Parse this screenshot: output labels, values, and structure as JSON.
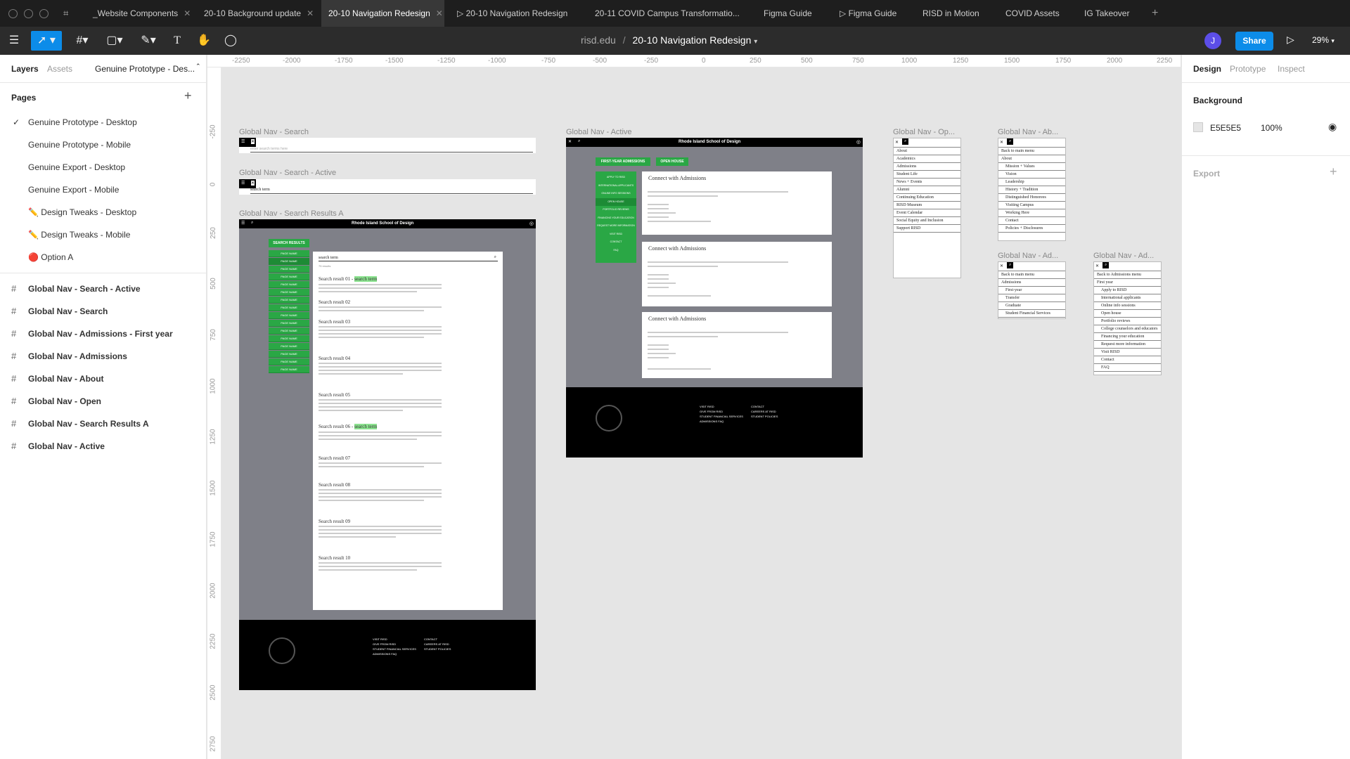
{
  "titlebar": {
    "tabs": [
      "_Website Components",
      "20-10 Background update",
      "20-10 Navigation Redesign",
      "20-10 Navigation Redesign",
      "20-11 COVID Campus Transformatio...",
      "Figma Guide",
      "Figma Guide",
      "RISD in Motion",
      "COVID Assets",
      "IG Takeover"
    ]
  },
  "toolbar": {
    "breadcrumb_team": "risd.edu",
    "breadcrumb_sep": "/",
    "file_title": "20-10 Navigation Redesign",
    "avatar": "J",
    "share": "Share",
    "zoom": "29%"
  },
  "left": {
    "tab_layers": "Layers",
    "tab_assets": "Assets",
    "page_selector": "Genuine Prototype - Des...",
    "pages_title": "Pages",
    "pages": [
      {
        "label": "Genuine Prototype - Desktop",
        "selected": true
      },
      {
        "label": "Genuine Prototype - Mobile"
      },
      {
        "label": "Genuine Export - Desktop"
      },
      {
        "label": "Genuine Export - Mobile"
      },
      {
        "label": "✏️ Design Tweaks - Desktop"
      },
      {
        "label": "✏️ Design Tweaks - Mobile"
      },
      {
        "label": "🔴 Option A"
      }
    ],
    "layers": [
      "Global Nav - Search - Active",
      "Global Nav - Search",
      "Global Nav - Admissions - First year",
      "Global Nav - Admissions",
      "Global Nav - About",
      "Global Nav - Open",
      "Global Nav - Search Results A",
      "Global Nav - Active"
    ]
  },
  "right": {
    "tab_design": "Design",
    "tab_prototype": "Prototype",
    "tab_inspect": "Inspect",
    "bg_title": "Background",
    "bg_hex": "E5E5E5",
    "bg_opacity": "100%",
    "export_title": "Export",
    "bg_color": "#e5e5e5"
  },
  "ruler": {
    "x": [
      "-2250",
      "-2000",
      "-1750",
      "-1500",
      "-1250",
      "-1000",
      "-750",
      "-500",
      "-250",
      "0",
      "250",
      "500",
      "750",
      "1000",
      "1250",
      "1500",
      "1750",
      "2000",
      "2250"
    ],
    "y": [
      "-250",
      "0",
      "250",
      "500",
      "750",
      "1000",
      "1250",
      "1500",
      "1750",
      "2000",
      "2250",
      "2500",
      "2750"
    ]
  },
  "canvas": {
    "labels": [
      "Global Nav - Search",
      "Global Nav - Search - Active",
      "Global Nav - Search Results A",
      "Global Nav - Active",
      "Global Nav - Op...",
      "Global Nav - Ab...",
      "Global Nav - Ad...",
      "Global Nav - Ad..."
    ],
    "search_placeholder": "enter search terms here",
    "search_term": "search term",
    "rsd_header": "Rhode Island School of Design",
    "search_results_btn": "SEARCH RESULTS",
    "page_name": "PAGE NAME",
    "results_input": "search term",
    "results_count": "75 results",
    "results": [
      "Search result 01 -",
      "Search result 02",
      "Search result 03",
      "Search result 04",
      "Search result 05",
      "Search result 06 -",
      "Search result 07",
      "Search result 08",
      "Search result 09",
      "Search result 10"
    ],
    "search_term_hl": "search term",
    "active_btns": [
      "FIRST-YEAR ADMISSIONS",
      "OPEN HOUSE"
    ],
    "active_side": [
      "APPLY TO RISD",
      "INTERNATIONAL APPLICANTS",
      "ONLINE INFO SESSIONS",
      "OPEN HOUSE",
      "PORTFOLIO REVIEWS",
      "FINANCING YOUR EDUCATION",
      "REQUEST MORE INFORMATION",
      "VISIT RISD",
      "CONTACT",
      "FAQ"
    ],
    "connect": "Connect with Admissions",
    "open_nav": [
      "About",
      "Academics",
      "Admissions",
      "Student Life",
      "News + Events",
      "Alumni",
      "Continuing Education",
      "RISD Museum",
      "Event Calendar",
      "Social Equity and Inclusion",
      "Support RISD"
    ],
    "about_nav": [
      "Back to main menu",
      "About",
      "Mission + Values",
      "Vision",
      "Leadership",
      "History + Tradition",
      "Distinguished Honorees",
      "Visiting Campus",
      "Working Here",
      "Contact",
      "Policies + Disclosures"
    ],
    "adm_nav": [
      "Back to main menu",
      "Admissions",
      "First-year",
      "Transfer",
      "Graduate",
      "Student Financial Services"
    ],
    "fy_nav": [
      "Back to Admissions menu",
      "First year",
      "Apply to RISD",
      "International applicants",
      "Online info sessions",
      "Open house",
      "Portfolio reviews",
      "College counselors and educators",
      "Financing your education",
      "Request more information",
      "Visit RISD",
      "Contact",
      "FAQ"
    ],
    "footer_links": [
      "VISIT RISD",
      "GIVE FROM RISD",
      "STUDENT FINANCIAL SERVICES",
      "ADMISSIONS FAQ",
      "CONTACT",
      "CAREERS AT RISD",
      "STUDENT POLICIES"
    ]
  },
  "help": "?"
}
